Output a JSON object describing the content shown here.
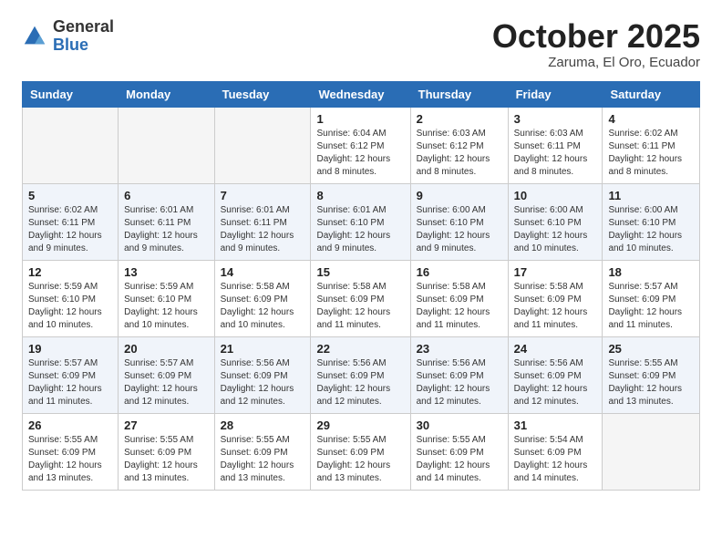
{
  "logo": {
    "general": "General",
    "blue": "Blue"
  },
  "title": "October 2025",
  "subtitle": "Zaruma, El Oro, Ecuador",
  "weekdays": [
    "Sunday",
    "Monday",
    "Tuesday",
    "Wednesday",
    "Thursday",
    "Friday",
    "Saturday"
  ],
  "weeks": [
    [
      {
        "day": "",
        "info": ""
      },
      {
        "day": "",
        "info": ""
      },
      {
        "day": "",
        "info": ""
      },
      {
        "day": "1",
        "info": "Sunrise: 6:04 AM\nSunset: 6:12 PM\nDaylight: 12 hours\nand 8 minutes."
      },
      {
        "day": "2",
        "info": "Sunrise: 6:03 AM\nSunset: 6:12 PM\nDaylight: 12 hours\nand 8 minutes."
      },
      {
        "day": "3",
        "info": "Sunrise: 6:03 AM\nSunset: 6:11 PM\nDaylight: 12 hours\nand 8 minutes."
      },
      {
        "day": "4",
        "info": "Sunrise: 6:02 AM\nSunset: 6:11 PM\nDaylight: 12 hours\nand 8 minutes."
      }
    ],
    [
      {
        "day": "5",
        "info": "Sunrise: 6:02 AM\nSunset: 6:11 PM\nDaylight: 12 hours\nand 9 minutes."
      },
      {
        "day": "6",
        "info": "Sunrise: 6:01 AM\nSunset: 6:11 PM\nDaylight: 12 hours\nand 9 minutes."
      },
      {
        "day": "7",
        "info": "Sunrise: 6:01 AM\nSunset: 6:11 PM\nDaylight: 12 hours\nand 9 minutes."
      },
      {
        "day": "8",
        "info": "Sunrise: 6:01 AM\nSunset: 6:10 PM\nDaylight: 12 hours\nand 9 minutes."
      },
      {
        "day": "9",
        "info": "Sunrise: 6:00 AM\nSunset: 6:10 PM\nDaylight: 12 hours\nand 9 minutes."
      },
      {
        "day": "10",
        "info": "Sunrise: 6:00 AM\nSunset: 6:10 PM\nDaylight: 12 hours\nand 10 minutes."
      },
      {
        "day": "11",
        "info": "Sunrise: 6:00 AM\nSunset: 6:10 PM\nDaylight: 12 hours\nand 10 minutes."
      }
    ],
    [
      {
        "day": "12",
        "info": "Sunrise: 5:59 AM\nSunset: 6:10 PM\nDaylight: 12 hours\nand 10 minutes."
      },
      {
        "day": "13",
        "info": "Sunrise: 5:59 AM\nSunset: 6:10 PM\nDaylight: 12 hours\nand 10 minutes."
      },
      {
        "day": "14",
        "info": "Sunrise: 5:58 AM\nSunset: 6:09 PM\nDaylight: 12 hours\nand 10 minutes."
      },
      {
        "day": "15",
        "info": "Sunrise: 5:58 AM\nSunset: 6:09 PM\nDaylight: 12 hours\nand 11 minutes."
      },
      {
        "day": "16",
        "info": "Sunrise: 5:58 AM\nSunset: 6:09 PM\nDaylight: 12 hours\nand 11 minutes."
      },
      {
        "day": "17",
        "info": "Sunrise: 5:58 AM\nSunset: 6:09 PM\nDaylight: 12 hours\nand 11 minutes."
      },
      {
        "day": "18",
        "info": "Sunrise: 5:57 AM\nSunset: 6:09 PM\nDaylight: 12 hours\nand 11 minutes."
      }
    ],
    [
      {
        "day": "19",
        "info": "Sunrise: 5:57 AM\nSunset: 6:09 PM\nDaylight: 12 hours\nand 11 minutes."
      },
      {
        "day": "20",
        "info": "Sunrise: 5:57 AM\nSunset: 6:09 PM\nDaylight: 12 hours\nand 12 minutes."
      },
      {
        "day": "21",
        "info": "Sunrise: 5:56 AM\nSunset: 6:09 PM\nDaylight: 12 hours\nand 12 minutes."
      },
      {
        "day": "22",
        "info": "Sunrise: 5:56 AM\nSunset: 6:09 PM\nDaylight: 12 hours\nand 12 minutes."
      },
      {
        "day": "23",
        "info": "Sunrise: 5:56 AM\nSunset: 6:09 PM\nDaylight: 12 hours\nand 12 minutes."
      },
      {
        "day": "24",
        "info": "Sunrise: 5:56 AM\nSunset: 6:09 PM\nDaylight: 12 hours\nand 12 minutes."
      },
      {
        "day": "25",
        "info": "Sunrise: 5:55 AM\nSunset: 6:09 PM\nDaylight: 12 hours\nand 13 minutes."
      }
    ],
    [
      {
        "day": "26",
        "info": "Sunrise: 5:55 AM\nSunset: 6:09 PM\nDaylight: 12 hours\nand 13 minutes."
      },
      {
        "day": "27",
        "info": "Sunrise: 5:55 AM\nSunset: 6:09 PM\nDaylight: 12 hours\nand 13 minutes."
      },
      {
        "day": "28",
        "info": "Sunrise: 5:55 AM\nSunset: 6:09 PM\nDaylight: 12 hours\nand 13 minutes."
      },
      {
        "day": "29",
        "info": "Sunrise: 5:55 AM\nSunset: 6:09 PM\nDaylight: 12 hours\nand 13 minutes."
      },
      {
        "day": "30",
        "info": "Sunrise: 5:55 AM\nSunset: 6:09 PM\nDaylight: 12 hours\nand 14 minutes."
      },
      {
        "day": "31",
        "info": "Sunrise: 5:54 AM\nSunset: 6:09 PM\nDaylight: 12 hours\nand 14 minutes."
      },
      {
        "day": "",
        "info": ""
      }
    ]
  ]
}
